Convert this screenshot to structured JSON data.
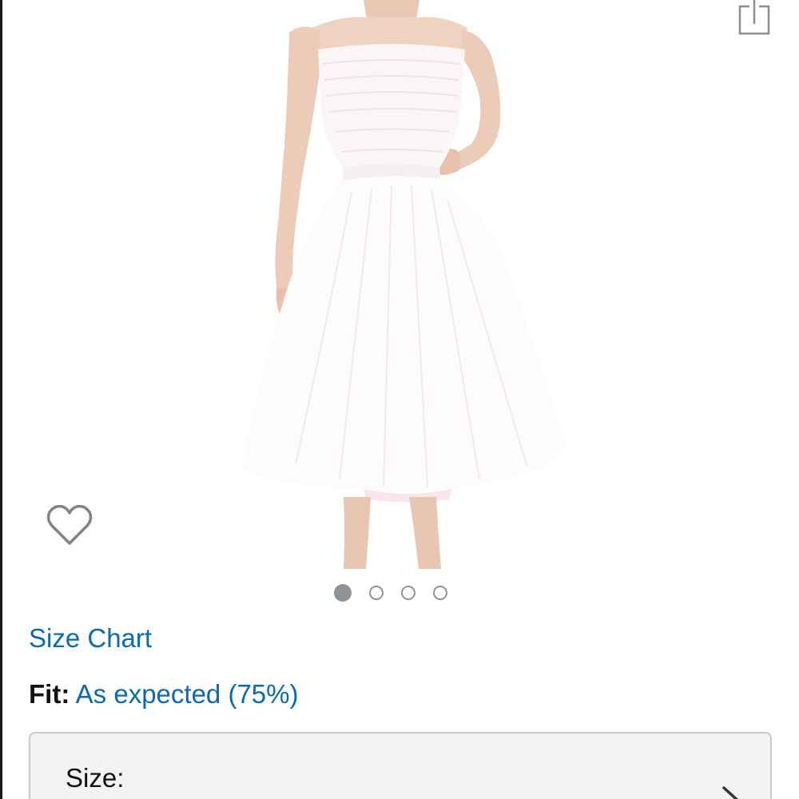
{
  "product": {
    "image_alt": "White strapless tulle tea-length dress",
    "image_count": 4,
    "active_image": 1
  },
  "icons": {
    "share": "share-icon",
    "wishlist": "heart-outline-icon",
    "chevron": "chevron-right-icon"
  },
  "links": {
    "size_chart": "Size Chart"
  },
  "fit": {
    "label": "Fit:",
    "value": "As expected (75%)"
  },
  "size_selector": {
    "label": "Size:"
  },
  "colors": {
    "link_blue": "#0a6ab3",
    "dot_gray": "#8f9397",
    "selector_bg": "#f1f2f2",
    "selector_border": "#c8cacc"
  }
}
